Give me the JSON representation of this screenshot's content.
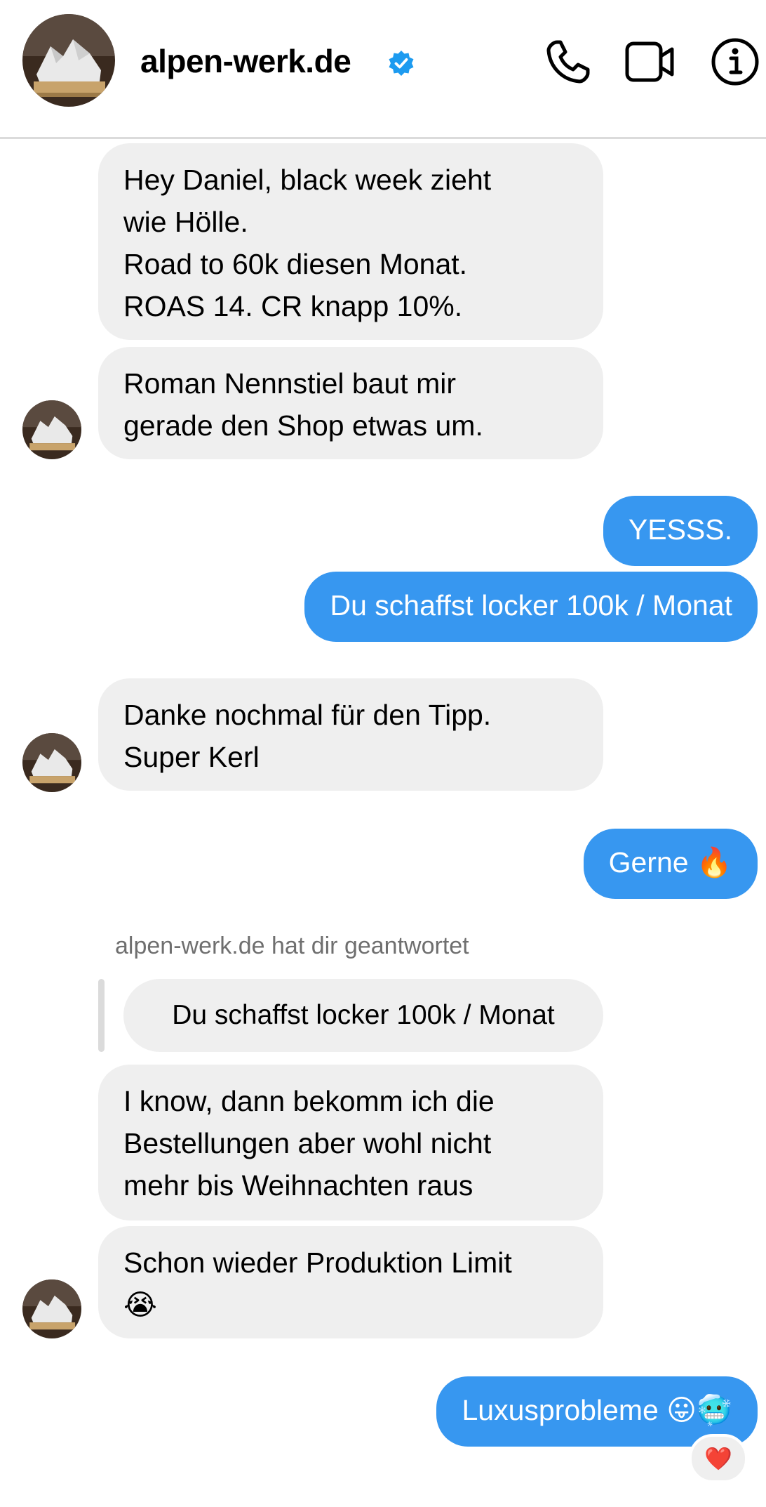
{
  "header": {
    "title": "alpen-werk.de",
    "icons": [
      "verified-badge-icon",
      "phone-icon",
      "video-camera-icon",
      "info-icon"
    ],
    "colors": {
      "verified": "#1d9bf0",
      "outgoing_bubble": "#3797f0",
      "incoming_bubble": "#efefef"
    }
  },
  "messages": {
    "m1": "Hey Daniel, black week zieht\nwie Hölle.\nRoad to 60k diesen Monat.\nROAS 14. CR knapp 10%.",
    "m2": "Roman Nennstiel baut mir\ngerade den Shop etwas um.",
    "m3": "YESSS.",
    "m4": "Du schaffst locker 100k / Monat",
    "m5": "Danke nochmal für den Tipp.\nSuper Kerl",
    "m6": "Gerne 🔥",
    "reply_label": "alpen-werk.de hat dir geantwortet",
    "reply_quote": "Du schaffst locker 100k / Monat",
    "m7": "I know, dann bekomm ich die\nBestellungen aber wohl nicht\nmehr bis Weihnachten raus",
    "m8": "Schon wieder Produktion Limit\n😭",
    "m9": "Luxusprobleme 😛🥶",
    "reaction": "❤️"
  }
}
